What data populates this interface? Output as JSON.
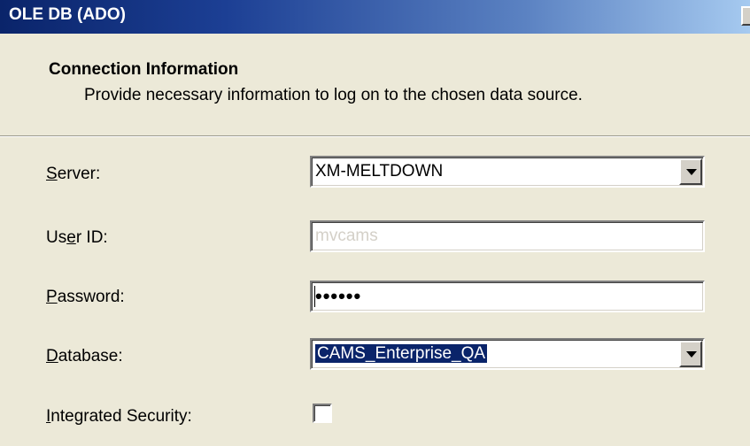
{
  "window": {
    "title": "OLE DB (ADO)"
  },
  "header": {
    "title": "Connection Information",
    "description": "Provide necessary information to log on to the chosen data source."
  },
  "form": {
    "server": {
      "label_prefix": "",
      "label_accel": "S",
      "label_suffix": "erver:",
      "value": "XM-MELTDOWN"
    },
    "user_id": {
      "label_prefix": "Us",
      "label_accel": "e",
      "label_suffix": "r ID:",
      "value": "mvcams"
    },
    "password": {
      "label_prefix": "",
      "label_accel": "P",
      "label_suffix": "assword:",
      "value": "••••••"
    },
    "database": {
      "label_prefix": "",
      "label_accel": "D",
      "label_suffix": "atabase:",
      "value": "CAMS_Enterprise_QA"
    },
    "integrated_security": {
      "label_prefix": "",
      "label_accel": "I",
      "label_suffix": "ntegrated Security:",
      "checked": false
    }
  },
  "colors": {
    "title_bar": "#0a246a",
    "selection": "#0a246a",
    "dialog_bg": "#ece9d8"
  }
}
